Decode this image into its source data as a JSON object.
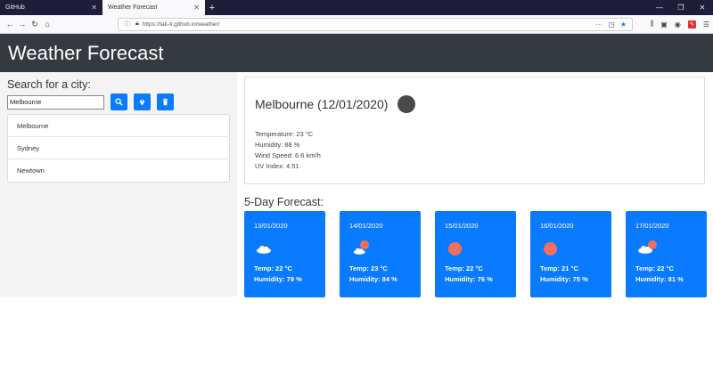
{
  "browser": {
    "tabs": [
      {
        "label": "GitHub",
        "active": false
      },
      {
        "label": "Weather Forecast",
        "active": true
      }
    ],
    "url": "https://tak-ti.github.io/weather/"
  },
  "app": {
    "title": "Weather Forecast"
  },
  "search": {
    "label": "Search for a city:",
    "value": "Melbourne",
    "buttons": [
      "search-icon",
      "location-icon",
      "trash-icon"
    ]
  },
  "cities": [
    {
      "name": "Melbourne"
    },
    {
      "name": "Sydney"
    },
    {
      "name": "Newtown"
    }
  ],
  "current": {
    "title": "Melbourne (12/01/2020)",
    "temperature": "Temperature: 23 °C",
    "humidity": "Humidity: 88 %",
    "wind": "Wind Speed: 6.6 km/h",
    "uv": "UV Index: 4.51"
  },
  "forecast": {
    "title": "5-Day Forecast:",
    "days": [
      {
        "date": "13/01/2020",
        "icon": "cloudy-icon",
        "temp": "Temp: 22 °C",
        "humidity": "Humidity: 79 %"
      },
      {
        "date": "14/01/2020",
        "icon": "partly-cloudy-icon",
        "temp": "Temp: 23 °C",
        "humidity": "Humidity: 84 %"
      },
      {
        "date": "15/01/2020",
        "icon": "sun-icon",
        "temp": "Temp: 22 °C",
        "humidity": "Humidity: 76 %"
      },
      {
        "date": "16/01/2020",
        "icon": "sun-icon",
        "temp": "Temp: 21 °C",
        "humidity": "Humidity: 75 %"
      },
      {
        "date": "17/01/2020",
        "icon": "partly-cloudy-icon",
        "temp": "Temp: 22 °C",
        "humidity": "Humidity: 81 %"
      }
    ]
  },
  "colors": {
    "header_bg": "#343a40",
    "accent": "#0a7bff",
    "sun": "#f07060"
  }
}
